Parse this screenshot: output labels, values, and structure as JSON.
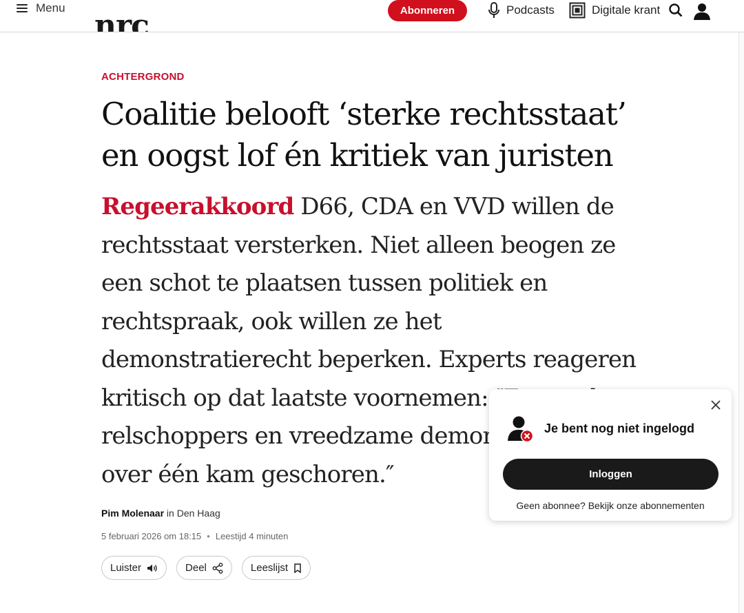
{
  "header": {
    "menu_label": "Menu",
    "logo_text": "nrc",
    "subscribe_label": "Abonneren",
    "podcasts_label": "Podcasts",
    "digital_paper_label": "Digitale krant",
    "icons": {
      "menu": "hamburger-icon",
      "podcasts": "microphone-icon",
      "digital_paper": "newspaper-icon",
      "search": "search-icon",
      "account": "user-icon"
    }
  },
  "article": {
    "kicker": "ACHTERGROND",
    "title": "Coalitie belooft ‘sterke rechtsstaat’ en oogst lof én kritiek van juristen",
    "lead_tag": "Regeerakkoord",
    "lead_text": "D66, CDA en VVD willen de rechtsstaat versterken. Niet alleen beogen ze een schot te plaatsen tussen politiek en rechtspraak, ook willen ze het demonstratierecht beperken. Experts reageren kritisch op dat laatste voornemen: ″Zo worden relschoppers en vreedzame demonstranten over één kam geschoren.″",
    "author": "Pim Molenaar",
    "location": "in Den Haag",
    "date": "5 februari 2026 om 18:15",
    "separator": "•",
    "reading_time": "Leestijd 4 minuten",
    "actions": {
      "listen": "Luister",
      "share": "Deel",
      "reading_list": "Leeslijst"
    }
  },
  "popup": {
    "headline": "Je bent nog niet ingelogd",
    "login_label": "Inloggen",
    "footer_text": "Geen abonnee? Bekijk onze abonnementen"
  },
  "colors": {
    "brand_red": "#c8102e",
    "subscribe_red": "#d0101c",
    "login_button": "#1a1a1a"
  }
}
